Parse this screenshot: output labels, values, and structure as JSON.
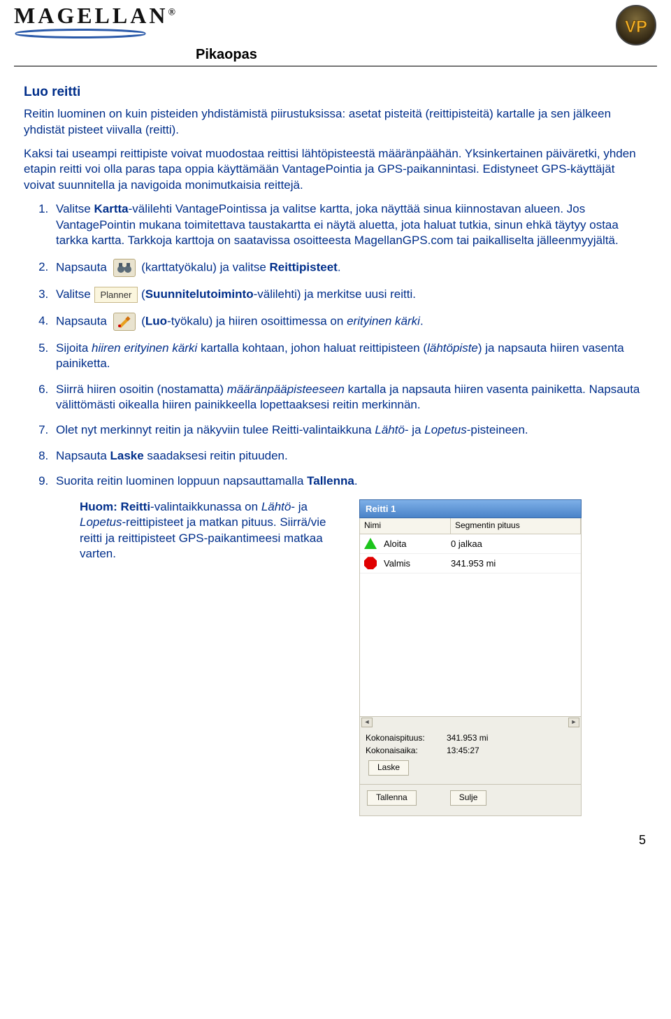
{
  "header": {
    "brand": "MAGELLAN",
    "page_title": "Pikaopas"
  },
  "icons": {
    "vp_label": "VP",
    "planner_label": "Planner"
  },
  "section": {
    "title": "Luo reitti",
    "intro1": "Reitin luominen on kuin pisteiden yhdistämistä piirustuksissa: asetat pisteitä (reittipisteitä) kartalle ja sen jälkeen yhdistät pisteet viivalla (reitti).",
    "intro2": "Kaksi tai useampi reittipiste voivat muodostaa reittisi lähtöpisteestä määränpäähän. Yksinkertainen päiväretki, yhden etapin reitti voi olla paras tapa oppia käyttämään VantagePointia ja GPS-paikannintasi. Edistyneet GPS-käyttäjät voivat suunnitella ja navigoida monimutkaisia reittejä."
  },
  "steps": {
    "s1a": "Valitse ",
    "s1b": "Kartta",
    "s1c": "-välilehti VantagePointissa ja valitse kartta, joka näyttää sinua kiinnostavan alueen. Jos VantagePointin mukana toimitettava taustakartta ei näytä aluetta, jota haluat tutkia, sinun ehkä täytyy ostaa tarkka kartta. Tarkkoja karttoja on saatavissa osoitteesta MagellanGPS.com tai paikalliselta jälleenmyyjältä.",
    "s2a": "Napsauta ",
    "s2b": " (karttatyökalu) ja valitse ",
    "s2c": "Reittipisteet",
    "s2d": ".",
    "s3a": "Valitse ",
    "s3b": " (",
    "s3c": "Suunnitelutoiminto",
    "s3d": "-välilehti) ja merkitse uusi reitti.",
    "s4a": "Napsauta ",
    "s4b": " (",
    "s4c": "Luo",
    "s4d": "-työkalu) ja hiiren osoittimessa on ",
    "s4e": "erityinen kärki",
    "s4f": ".",
    "s5a": "Sijoita  ",
    "s5b": "hiiren erityinen kärki",
    "s5c": " kartalla kohtaan, johon haluat reittipisteen (",
    "s5d": "lähtöpiste",
    "s5e": ") ja napsauta hiiren vasenta painiketta.",
    "s6a": "Siirrä hiiren osoitin (nostamatta) ",
    "s6b": "määränpääpisteeseen",
    "s6c": " kartalla ja napsauta hiiren vasenta painiketta. Napsauta välittömästi oikealla hiiren painikkeella lopettaaksesi reitin merkinnän.",
    "s7a": "Olet nyt merkinnyt reitin ja näkyviin tulee Reitti-valintaikkuna ",
    "s7b": "Lähtö",
    "s7c": "- ja ",
    "s7d": "Lopetus",
    "s7e": "-pisteineen.",
    "s8a": "Napsauta ",
    "s8b": "Laske",
    "s8c": " saadaksesi reitin pituuden.",
    "s9a": "Suorita reitin luominen loppuun napsauttamalla ",
    "s9b": "Tallenna",
    "s9c": "."
  },
  "note": {
    "a": "Huom: Reitti",
    "b": "-valintaikkunassa on ",
    "c": "Lähtö",
    "d": "- ja ",
    "e": "Lopetus",
    "f": "-reittipisteet ja matkan pituus. Siirrä/vie reitti ja reittipisteet GPS-paikantimeesi matkaa varten."
  },
  "panel": {
    "title": "Reitti 1",
    "col_name": "Nimi",
    "col_seg": "Segmentin pituus",
    "row1": {
      "name": "Aloita",
      "seg": "0 jalkaa"
    },
    "row2": {
      "name": "Valmis",
      "seg": "341.953 mi"
    },
    "total_len_lbl": "Kokonaispituus:",
    "total_len_val": "341.953 mi",
    "total_time_lbl": "Kokonaisaika:",
    "total_time_val": "13:45:27",
    "btn_calc": "Laske",
    "btn_save": "Tallenna",
    "btn_close": "Sulje"
  },
  "page_number": "5"
}
